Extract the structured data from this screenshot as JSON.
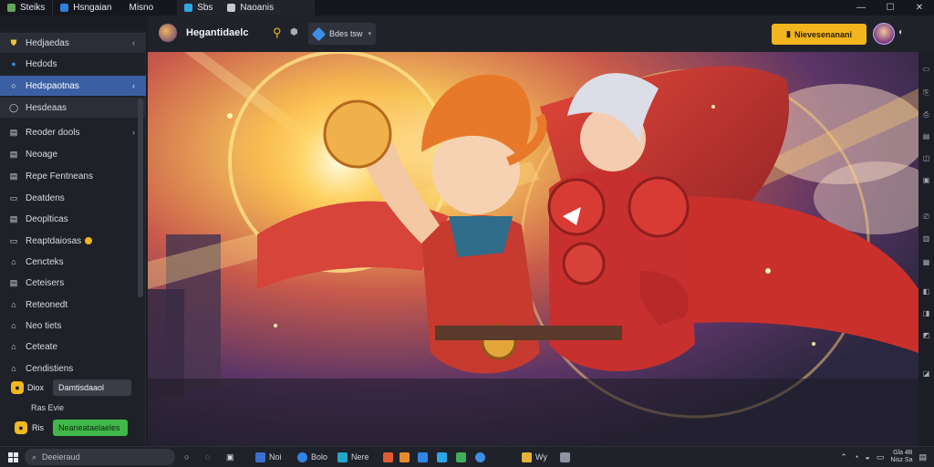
{
  "titlebar": {
    "app_label": "Steiks",
    "tab1_label": "Hsngaian",
    "tab1_suffix": "Misno",
    "tab2_label": "Sbs",
    "tab3_label": "Naoanis",
    "controls": [
      "—",
      "☐",
      "✕"
    ]
  },
  "header": {
    "app_name": "Hegantidaelc",
    "dropdown_label": "Bdes tsw",
    "cta_label": "Nievesenanani"
  },
  "sidebar": {
    "items": [
      {
        "label": "Hedjaedas",
        "icon": "shield-icon",
        "chevron": "‹"
      },
      {
        "label": "Hedods",
        "icon": "circle-icon",
        "chevron": ""
      },
      {
        "label": "Hedspaotnas",
        "icon": "circle-icon",
        "chevron": "‹"
      },
      {
        "label": "Hesdeaas",
        "icon": "ring-icon",
        "chevron": ""
      },
      {
        "label": "Reoder dools",
        "icon": "doc-icon",
        "chevron": "›"
      },
      {
        "label": "Neoage",
        "icon": "doc-icon",
        "chevron": ""
      },
      {
        "label": "Repe Fentneans",
        "icon": "doc-icon",
        "chevron": ""
      },
      {
        "label": "Deatdens",
        "icon": "doc-icon",
        "chevron": ""
      },
      {
        "label": "Deoplticas",
        "icon": "doc-icon",
        "chevron": ""
      },
      {
        "label": "Reaptdaiosas",
        "icon": "doc-icon",
        "chevron": ""
      },
      {
        "label": "Cencteks",
        "icon": "doc-icon",
        "chevron": ""
      },
      {
        "label": "Ceteisers",
        "icon": "doc-icon",
        "chevron": ""
      },
      {
        "label": "Reteonedt",
        "icon": "doc-icon",
        "chevron": ""
      },
      {
        "label": "Neo tiets",
        "icon": "doc-icon",
        "chevron": ""
      },
      {
        "label": "Ceteate",
        "icon": "doc-icon",
        "chevron": ""
      },
      {
        "label": "Cendistiens",
        "icon": "doc-icon",
        "chevron": ""
      }
    ],
    "footer_row1": {
      "label": "Diox",
      "pill": "Damtisdaaol"
    },
    "footer_row2": {
      "label": "Ras Evie"
    },
    "footer_row3": {
      "label": "Ris",
      "pill": "Neaneataelaeles"
    }
  },
  "taskbar": {
    "search_placeholder": "Deeieraud",
    "apps": [
      {
        "label": "Noi",
        "color": "#3d6fd1"
      },
      {
        "label": "Bolo",
        "color": "#2f86e6"
      },
      {
        "label": "Nere",
        "color": "#23a6c8"
      },
      {
        "label": "",
        "color": "#e05a33"
      },
      {
        "label": "",
        "color": "#e98a2a"
      },
      {
        "label": "",
        "color": "#2f86e6"
      },
      {
        "label": "",
        "color": "#2aa7e4"
      },
      {
        "label": "",
        "color": "#3fae5a"
      },
      {
        "label": "",
        "color": "#3d8ee6"
      },
      {
        "label": "Wy",
        "color": "#e6b338"
      },
      {
        "label": "",
        "color": "#8c93a3"
      }
    ],
    "clock_time": "Gla 4B",
    "clock_date": "Nisz Sa"
  },
  "colors": {
    "accent": "#3b5fa3",
    "cta": "#f3b51d",
    "pill_green": "#41b84a"
  }
}
